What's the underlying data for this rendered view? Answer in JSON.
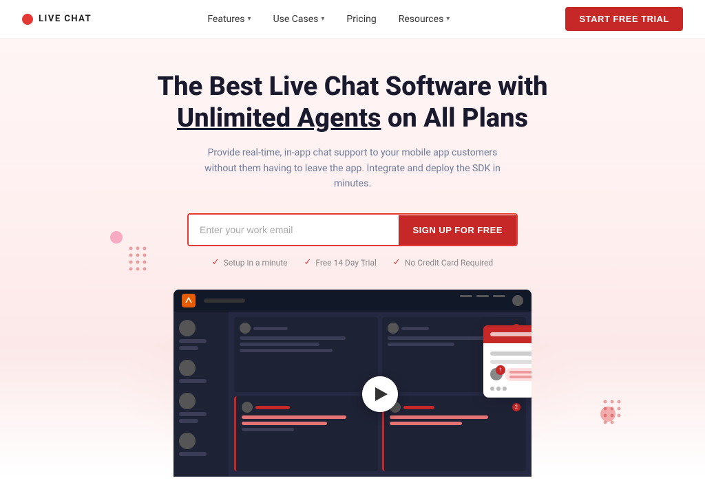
{
  "nav": {
    "logo_text": "LIVE CHAT",
    "links": [
      {
        "label": "Features",
        "has_dropdown": true
      },
      {
        "label": "Use Cases",
        "has_dropdown": true
      },
      {
        "label": "Pricing",
        "has_dropdown": false
      },
      {
        "label": "Resources",
        "has_dropdown": true
      }
    ],
    "cta_label": "START FREE TRIAL"
  },
  "hero": {
    "title_part1": "The Best Live Chat Software with",
    "title_highlight": "Unlimited Agents",
    "title_part2": " on All Plans",
    "subtitle": "Provide real-time, in-app chat support to your mobile app customers without them having to leave the app. Integrate and deploy the SDK in minutes.",
    "email_placeholder": "Enter your work email",
    "signup_button": "SIGN UP FOR FREE",
    "badges": [
      {
        "icon": "✓",
        "text": "Setup in a minute"
      },
      {
        "icon": "✓",
        "text": "Free 14 Day Trial"
      },
      {
        "icon": "✓",
        "text": "No Credit Card Required"
      }
    ]
  },
  "colors": {
    "primary_red": "#c62828",
    "light_red": "#e53935",
    "bg_gradient_start": "#fff5f5"
  }
}
